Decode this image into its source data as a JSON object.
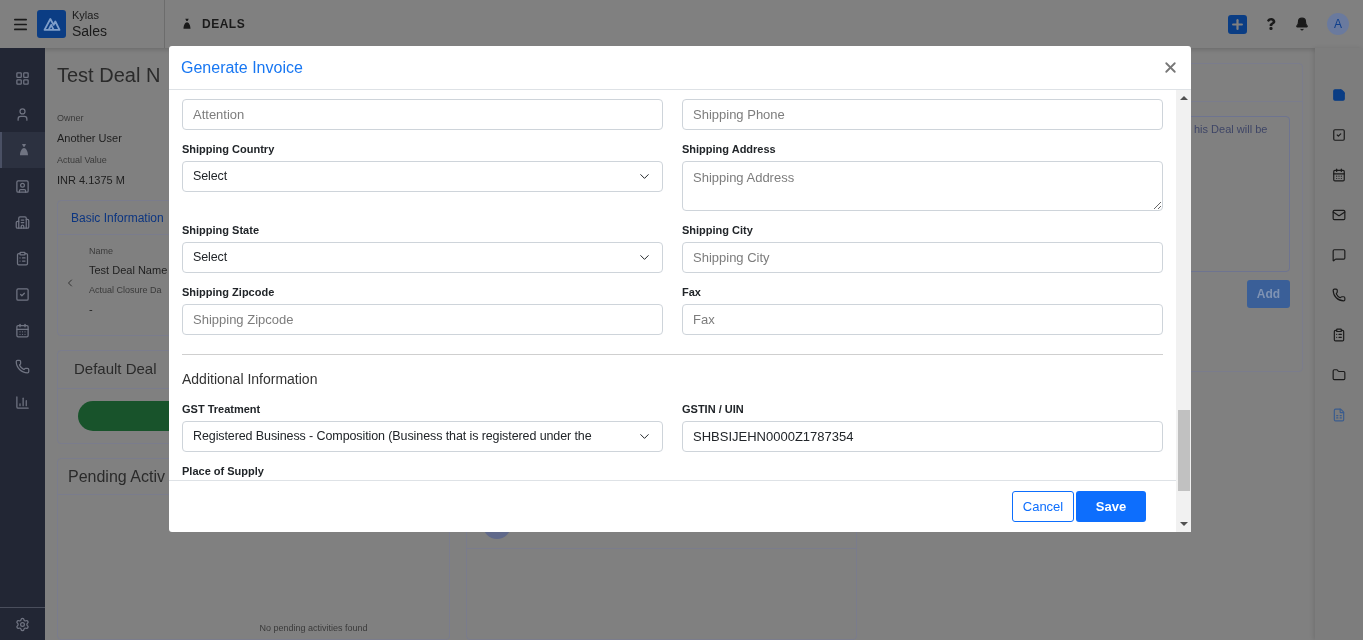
{
  "topbar": {
    "app_name": "Kylas",
    "app_product": "Sales",
    "section": "DEALS",
    "avatar": "A"
  },
  "sidebar": {
    "items": [
      {
        "kind": "dashboard",
        "selected": false
      },
      {
        "kind": "user",
        "selected": false
      },
      {
        "kind": "deal",
        "selected": true
      },
      {
        "kind": "contact",
        "selected": false
      },
      {
        "kind": "company",
        "selected": false
      },
      {
        "kind": "clipboard",
        "selected": false
      },
      {
        "kind": "task",
        "selected": false
      },
      {
        "kind": "calendar",
        "selected": false
      },
      {
        "kind": "call",
        "selected": false
      },
      {
        "kind": "report",
        "selected": false
      }
    ]
  },
  "rail": {
    "items": [
      {
        "kind": "note",
        "selected": true
      },
      {
        "kind": "task",
        "selected": false
      },
      {
        "kind": "calendar",
        "selected": false
      },
      {
        "kind": "mail",
        "selected": false
      },
      {
        "kind": "chat",
        "selected": false
      },
      {
        "kind": "call",
        "selected": false
      },
      {
        "kind": "clipboard",
        "selected": false
      },
      {
        "kind": "folder",
        "selected": false
      },
      {
        "kind": "document",
        "selected": false
      }
    ]
  },
  "deal": {
    "title": "Test Deal N",
    "owner_label": "Owner",
    "owner": "Another User",
    "value_label": "Actual Value",
    "value": "INR 4.1375 M"
  },
  "basic_info": {
    "tab": "Basic Information",
    "fields": [
      {
        "label": "Name",
        "value": "Test Deal Name"
      },
      {
        "label": "Actual Closure Da",
        "value": "-"
      }
    ]
  },
  "pipeline": {
    "title": "Default Deal"
  },
  "activities": {
    "title": "Pending Activ",
    "empty": "No pending activities found"
  },
  "notes": {
    "placeholder": "his Deal will be",
    "add": "Add"
  },
  "modal": {
    "title": "Generate Invoice",
    "shipping_fields": [
      {
        "kind": "input",
        "placeholder": "Attention"
      },
      {
        "kind": "input",
        "placeholder": "Shipping Phone"
      },
      {
        "label": "Shipping Country",
        "kind": "select",
        "value": "Select"
      },
      {
        "label": "Shipping Address",
        "kind": "textarea",
        "placeholder": "Shipping Address"
      },
      {
        "label": "Shipping State",
        "kind": "select",
        "value": "Select"
      },
      {
        "label": "Shipping City",
        "kind": "input",
        "placeholder": "Shipping City"
      },
      {
        "label": "Shipping Zipcode",
        "kind": "input",
        "placeholder": "Shipping Zipcode"
      },
      {
        "label": "Fax",
        "kind": "input",
        "placeholder": "Fax"
      }
    ],
    "section": "Additional Information",
    "additional_fields": [
      {
        "label": "GST Treatment",
        "kind": "select",
        "value": "Registered Business - Composition (Business that is registered under the"
      },
      {
        "label": "GSTIN / UIN",
        "kind": "input",
        "value": "SHBSIJEHN0000Z1787354"
      },
      {
        "label": "Place of Supply"
      }
    ],
    "buttons": [
      {
        "label": "Cancel",
        "kind": "secondary"
      },
      {
        "label": "Save",
        "kind": "primary"
      }
    ]
  }
}
